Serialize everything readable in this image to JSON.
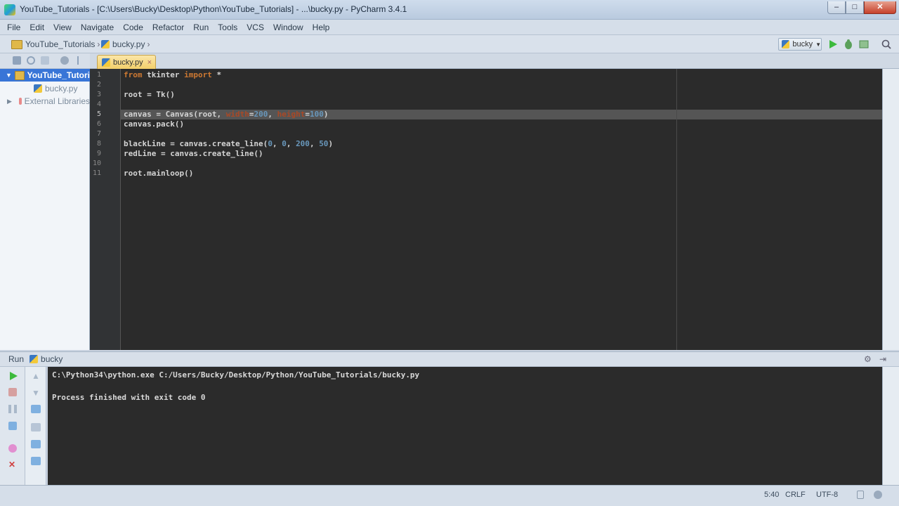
{
  "window": {
    "title": "YouTube_Tutorials - [C:\\Users\\Bucky\\Desktop\\Python\\YouTube_Tutorials] - ...\\bucky.py - PyCharm 3.4.1",
    "minimize": "–",
    "maximize": "□",
    "close": "✕"
  },
  "menu": [
    "File",
    "Edit",
    "View",
    "Navigate",
    "Code",
    "Refactor",
    "Run",
    "Tools",
    "VCS",
    "Window",
    "Help"
  ],
  "breadcrumb": {
    "project": "YouTube_Tutorials",
    "file": "bucky.py"
  },
  "run_config": "bucky",
  "project_tree": {
    "root": "YouTube_Tutori",
    "file": "bucky.py",
    "libraries": "External Libraries"
  },
  "editor": {
    "tab": "bucky.py",
    "line_numbers": [
      "1",
      "2",
      "3",
      "4",
      "5",
      "6",
      "7",
      "8",
      "9",
      "10",
      "11"
    ],
    "lines": {
      "l1_kw1": "from",
      "l1_mod": " tkinter ",
      "l1_kw2": "import",
      "l1_rest": " *",
      "l3": "root = Tk()",
      "l5_a": "canvas = Canvas(root, ",
      "l5_p1": "width",
      "l5_eq1": "=",
      "l5_n1": "200",
      "l5_c": ", ",
      "l5_p2": "height",
      "l5_eq2": "=",
      "l5_n2": "100",
      "l5_end": ")",
      "l6": "canvas.pack()",
      "l8_a": "blackLine = canvas.create_line(",
      "l8_n1": "0",
      "l8_c1": ", ",
      "l8_n2": "0",
      "l8_c2": ", ",
      "l8_n3": "200",
      "l8_c3": ", ",
      "l8_n4": "50",
      "l8_end": ")",
      "l9": "redLine = canvas.create_line()",
      "l11": "root.mainloop()"
    }
  },
  "run_panel": {
    "label": "Run",
    "config": "bucky",
    "output": [
      "C:\\Python34\\python.exe C:/Users/Bucky/Desktop/Python/YouTube_Tutorials/bucky.py",
      "",
      "Process finished with exit code 0"
    ]
  },
  "status": {
    "position": "5:40",
    "line_sep": "CRLF",
    "encoding": "UTF-8"
  }
}
